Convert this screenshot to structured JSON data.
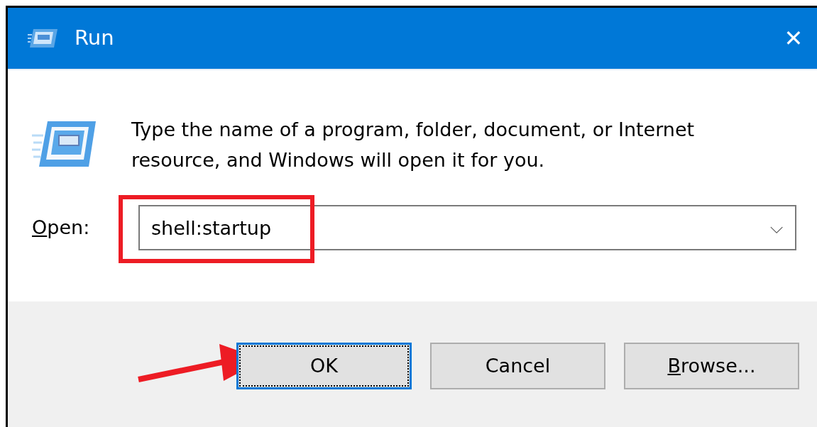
{
  "window": {
    "title": "Run",
    "close": "✕"
  },
  "message": "Type the name of a program, folder, document, or Internet resource, and Windows will open it for you.",
  "open_field": {
    "label": {
      "key": "O",
      "rest": "pen:"
    },
    "value": "shell:startup",
    "dropdown": "⌵"
  },
  "buttons": [
    {
      "label": {
        "rest": "OK"
      },
      "default": true,
      "focused": true
    },
    {
      "label": {
        "rest": "Cancel"
      },
      "default": false,
      "focused": false
    },
    {
      "label": {
        "key": "B",
        "rest": "rowse..."
      },
      "default": false,
      "focused": false
    }
  ],
  "highlight_box": {
    "color": "#ed1c24"
  },
  "arrow": {
    "color": "#ed1c24"
  }
}
